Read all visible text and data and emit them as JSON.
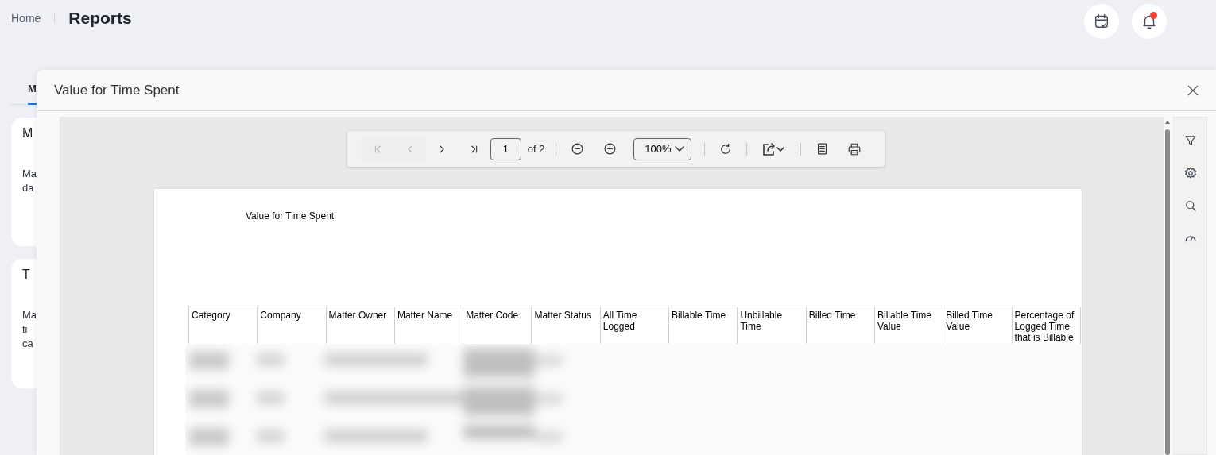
{
  "breadcrumb": {
    "home": "Home",
    "title": "Reports"
  },
  "header_icons": [
    {
      "kind": "calendar",
      "badge": false
    },
    {
      "kind": "bell",
      "badge": true
    }
  ],
  "tabs": [
    {
      "label": "M",
      "selected": true
    }
  ],
  "cards": [
    {
      "title": "M",
      "lines": [
        "Ma",
        "da"
      ]
    },
    {
      "title": "T",
      "lines": [
        "Ma",
        "ti",
        "ca"
      ]
    }
  ],
  "modal": {
    "title": "Value for Time Spent",
    "toolbar": {
      "page": "1",
      "of": "of 2",
      "zoom": "100%",
      "buttons": [
        {
          "kind": "first",
          "disabled": true
        },
        {
          "kind": "prev",
          "disabled": true
        },
        {
          "kind": "next",
          "disabled": false
        },
        {
          "kind": "last",
          "disabled": false
        }
      ]
    },
    "report": {
      "title": "Value for Time Spent",
      "columns": [
        "Category",
        "Company",
        "Matter Owner",
        "Matter Name",
        "Matter Code",
        "Matter Status",
        "All Time Logged",
        "Billable Time",
        "Unbillable Time",
        "Billed Time",
        "Billable Time Value",
        "Billed Time Value",
        "Percentage of Logged Time that is Billable"
      ]
    }
  }
}
